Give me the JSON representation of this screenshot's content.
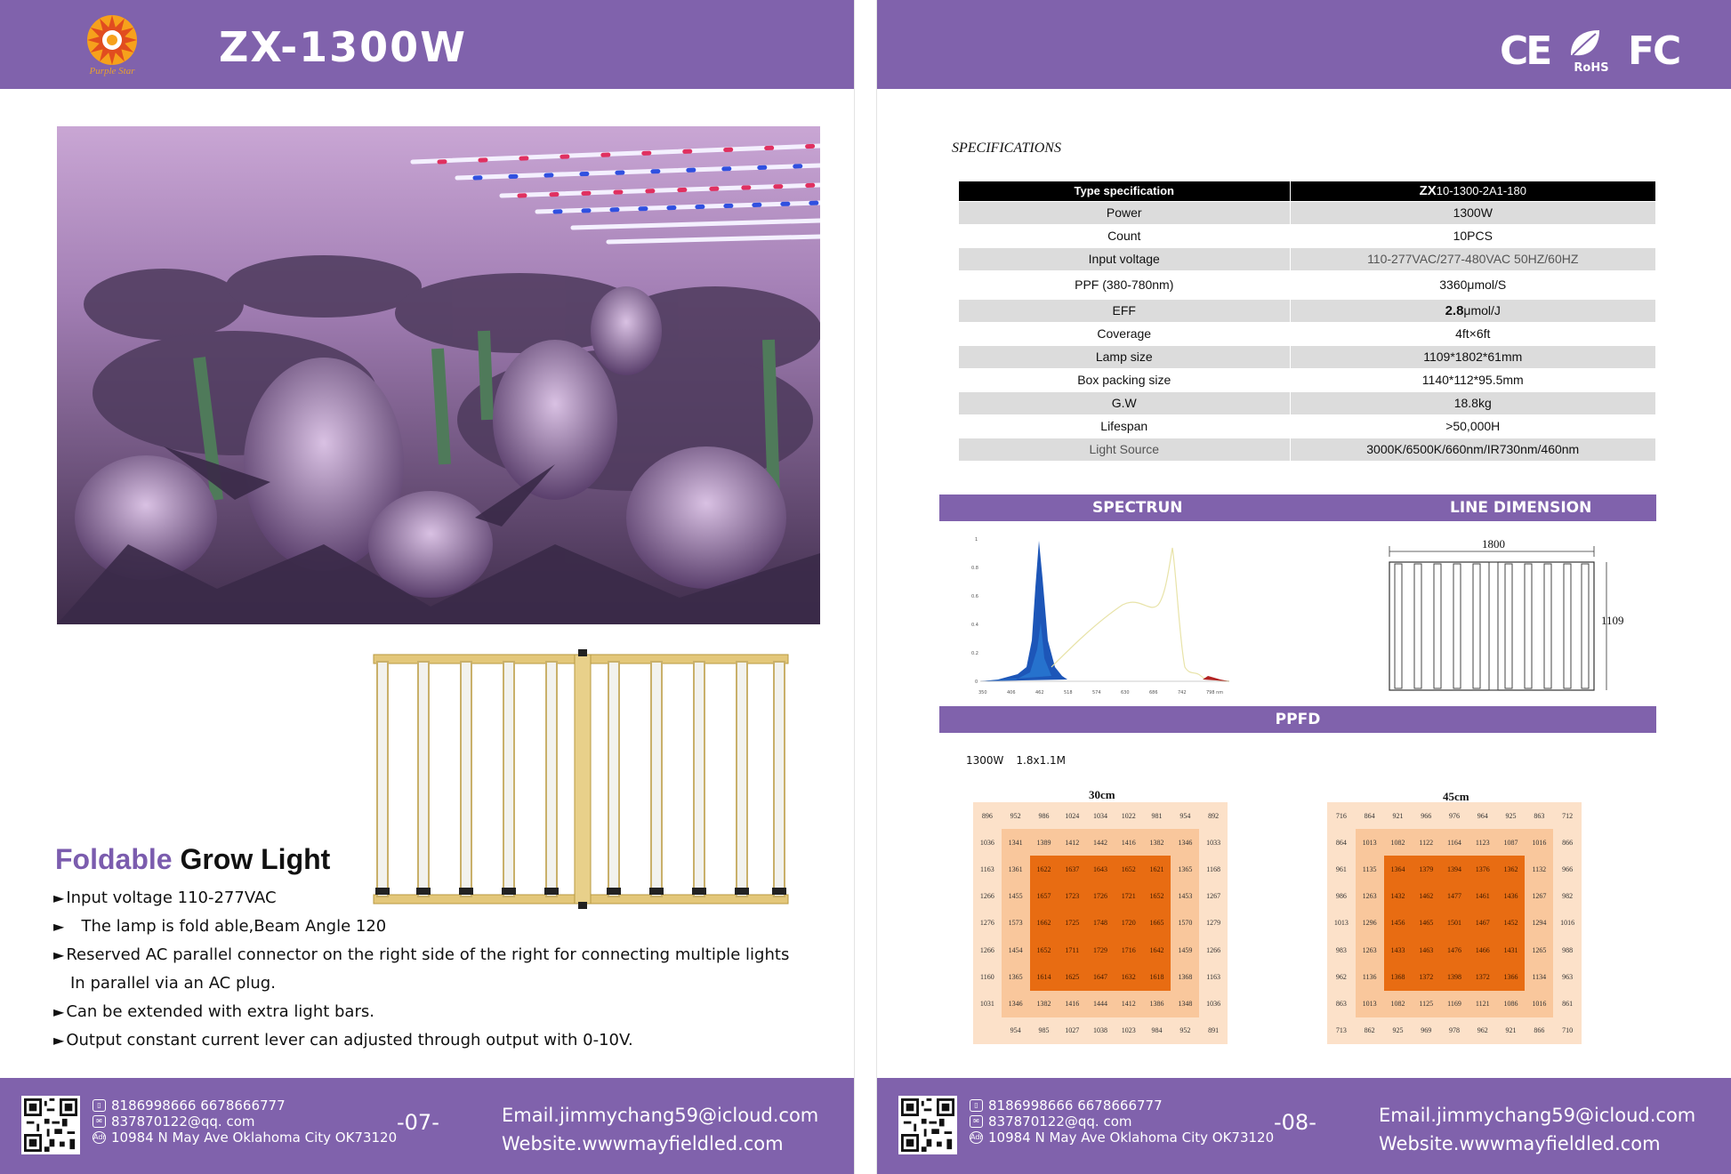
{
  "left_page": {
    "brand": {
      "logo_text": "Purple Star"
    },
    "model_title": "ZX-1300W",
    "feature_heading": {
      "accent": "Foldable",
      "rest": "Grow Light"
    },
    "bullets": [
      "Input voltage 110-277VAC",
      "The lamp is fold able,Beam Angle 120",
      "Reserved AC parallel connector on the right side of the right for connecting multiple lights",
      "In parallel via an AC plug.",
      "Can be extended with extra light bars.",
      "Output constant current lever can adjusted through output with 0-10V."
    ],
    "footer": {
      "phones": "8186998666  6678666777",
      "email_short": "837870122@qq. com",
      "address": "10984 N May Ave Oklahoma City OK73120",
      "address_icon_label": "Adr",
      "page_number": "-07-",
      "email": "Email.jimmychang59@icloud.com",
      "website": "Website.wwwmayfieldled.com"
    }
  },
  "right_page": {
    "certifications": {
      "ce": "CE",
      "rohs": "RoHS",
      "fc": "FC"
    },
    "spec_heading": "SPECIFICATIONS",
    "spec_table": {
      "header_key": "Type specification",
      "header_value_bold": "ZX",
      "header_value_rest": "10-1300-2A1-180",
      "rows": [
        {
          "key": "Power",
          "value": "1300W"
        },
        {
          "key": "Count",
          "value": "10PCS"
        },
        {
          "key": "Input voltage",
          "value": "110-277VAC/277-480VAC 50HZ/60HZ"
        },
        {
          "key": "PPF (380-780nm)",
          "value": "3360μmol/S"
        },
        {
          "key": "EFF",
          "value_bold": "2.8",
          "value": "μmol/J"
        },
        {
          "key": "Coverage",
          "value": "4ft×6ft"
        },
        {
          "key": "Lamp size",
          "value": "1109*1802*61mm"
        },
        {
          "key": "Box packing size",
          "value": "1140*112*95.5mm"
        },
        {
          "key": "G.W",
          "value": "18.8kg"
        },
        {
          "key": "Lifespan",
          "value": ">50,000H"
        },
        {
          "key": "Light Source",
          "value": "3000K/6500K/660nm/IR730nm/460nm"
        }
      ]
    },
    "section_labels": {
      "spectrum": "SPECTRUN",
      "dimension": "LINE DIMENSION",
      "ppfd": "PPFD"
    },
    "spectrum_chart": {
      "y_ticks": [
        "1",
        "0.8",
        "0.6",
        "0.4",
        "0.2",
        "0"
      ],
      "x_ticks": [
        "350",
        "406",
        "462",
        "518",
        "574",
        "630",
        "686",
        "742",
        "798 nm"
      ]
    },
    "dimension": {
      "width": "1800",
      "height": "1109"
    },
    "ppfd": {
      "caption_power": "1300W",
      "caption_area": "1.8x1.1M",
      "grids": [
        {
          "title": "30cm",
          "rows": [
            [
              "896",
              "952",
              "986",
              "1024",
              "1034",
              "1022",
              "981",
              "954",
              "892"
            ],
            [
              "1036",
              "1341",
              "1389",
              "1412",
              "1442",
              "1416",
              "1382",
              "1346",
              "1033"
            ],
            [
              "1163",
              "1361",
              "1622",
              "1637",
              "1643",
              "1652",
              "1621",
              "1365",
              "1168"
            ],
            [
              "1266",
              "1455",
              "1657",
              "1723",
              "1726",
              "1721",
              "1652",
              "1453",
              "1267"
            ],
            [
              "1276",
              "1573",
              "1662",
              "1725",
              "1748",
              "1720",
              "1665",
              "1570",
              "1279"
            ],
            [
              "1266",
              "1454",
              "1652",
              "1711",
              "1729",
              "1716",
              "1642",
              "1459",
              "1266"
            ],
            [
              "1160",
              "1365",
              "1614",
              "1625",
              "1647",
              "1632",
              "1618",
              "1368",
              "1163"
            ],
            [
              "1031",
              "1346",
              "1382",
              "1416",
              "1444",
              "1412",
              "1386",
              "1348",
              "1036"
            ],
            [
              "",
              "954",
              "985",
              "1027",
              "1038",
              "1023",
              "984",
              "952",
              "891"
            ]
          ]
        },
        {
          "title": "45cm",
          "rows": [
            [
              "716",
              "864",
              "921",
              "966",
              "976",
              "964",
              "925",
              "863",
              "712"
            ],
            [
              "864",
              "1013",
              "1082",
              "1122",
              "1164",
              "1123",
              "1087",
              "1016",
              "866"
            ],
            [
              "961",
              "1135",
              "1364",
              "1379",
              "1394",
              "1376",
              "1362",
              "1132",
              "966"
            ],
            [
              "986",
              "1263",
              "1432",
              "1462",
              "1477",
              "1461",
              "1436",
              "1267",
              "982"
            ],
            [
              "1013",
              "1296",
              "1456",
              "1465",
              "1501",
              "1467",
              "1452",
              "1294",
              "1016"
            ],
            [
              "983",
              "1263",
              "1433",
              "1463",
              "1476",
              "1466",
              "1431",
              "1265",
              "988"
            ],
            [
              "962",
              "1136",
              "1368",
              "1372",
              "1398",
              "1372",
              "1366",
              "1134",
              "963"
            ],
            [
              "863",
              "1013",
              "1082",
              "1125",
              "1169",
              "1121",
              "1086",
              "1016",
              "861"
            ],
            [
              "713",
              "862",
              "925",
              "969",
              "978",
              "962",
              "921",
              "866",
              "710"
            ]
          ]
        }
      ]
    },
    "footer": {
      "phones": "8186998666  6678666777",
      "email_short": "837870122@qq. com",
      "address": "10984 N May Ave Oklahoma City OK73120",
      "address_icon_label": "Adr",
      "page_number": "-08-",
      "email": "Email.jimmychang59@icloud.com",
      "website": "Website.wwwmayfieldled.com"
    }
  },
  "colors": {
    "band": "#8062ac",
    "accent_text": "#7b5cae",
    "ppfd_low": "#fce1c9",
    "ppfd_mid": "#f9c79c",
    "ppfd_high": "#e86c12"
  }
}
